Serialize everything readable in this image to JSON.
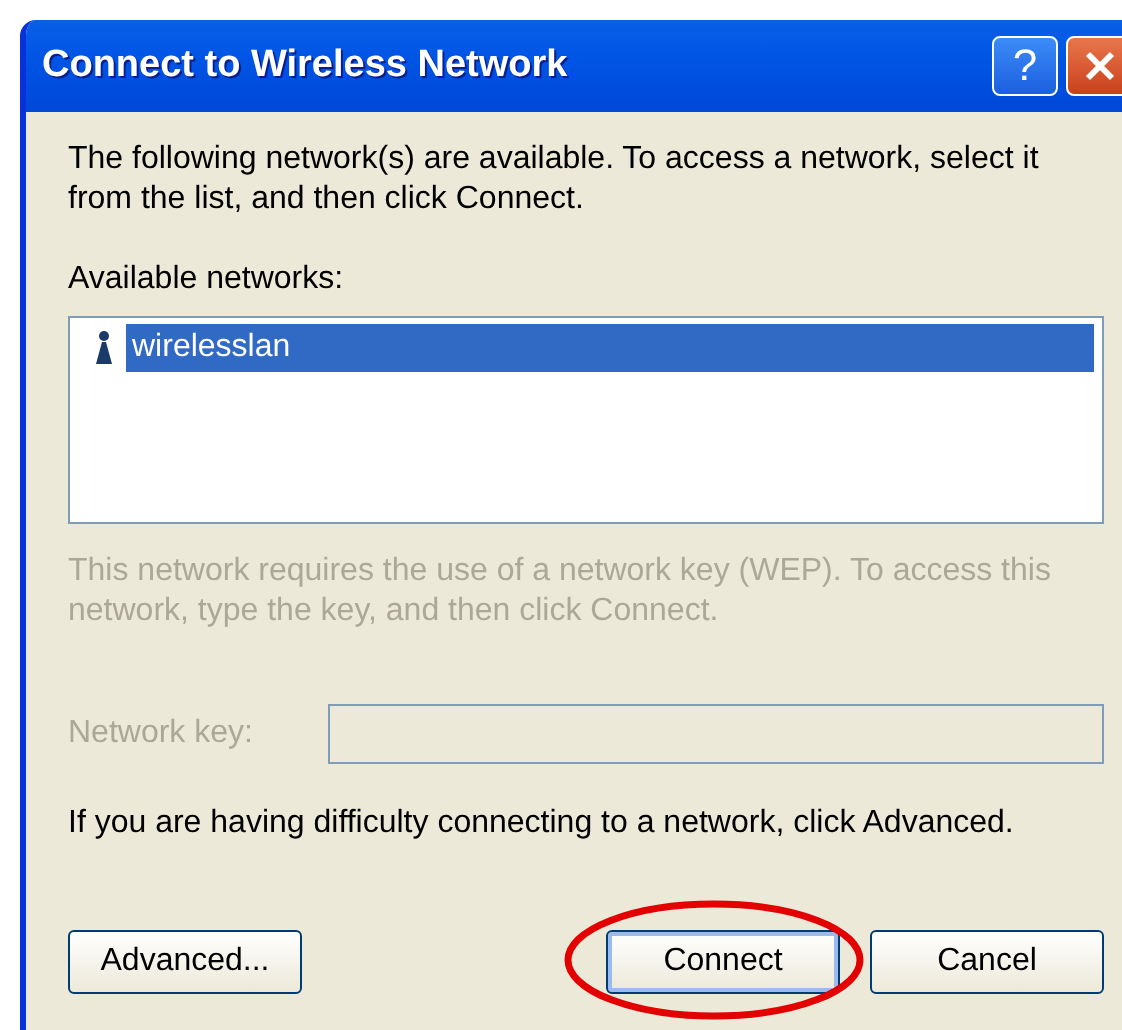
{
  "window": {
    "title": "Connect to Wireless Network",
    "help_button": "?"
  },
  "intro": "The following network(s) are available. To access a network, select it from the list, and then click Connect.",
  "networks_label": "Available networks:",
  "networks": [
    {
      "name": "wirelesslan",
      "selected": true
    }
  ],
  "key_section": {
    "disabled": true,
    "text": "This network requires the use of a network key (WEP). To access this network, type the key, and then click Connect.",
    "label": "Network key:"
  },
  "hint": "If you are having difficulty connecting to a network, click Advanced.",
  "buttons": [
    {
      "label": "Advanced...",
      "highlighted": false
    },
    {
      "label": "Connect",
      "highlighted": true
    },
    {
      "label": "Cancel",
      "highlighted": false
    }
  ]
}
